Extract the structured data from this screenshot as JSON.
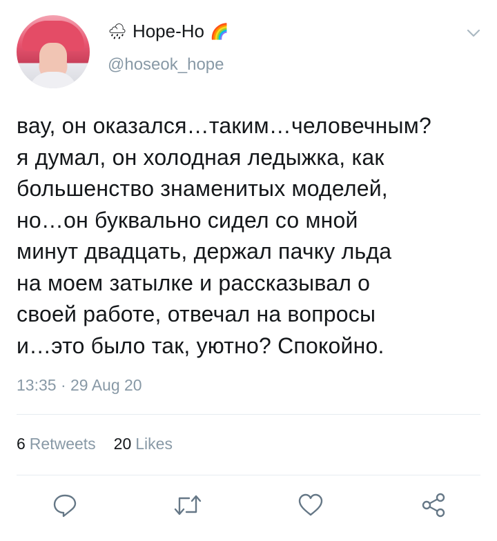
{
  "author": {
    "name": "Hope-Ho",
    "handle": "@hoseok_hope",
    "name_prefix_emoji": "🌧",
    "name_suffix_emoji": "🌈"
  },
  "tweet": {
    "text": "вау, он оказался…таким…человечным?\nя думал, он холодная ледыжка, как\nбольшенство знаменитых моделей,\nно…он буквально сидел со мной\nминут двадцать, держал пачку льда\nна моем затылке и рассказывал о\nсвоей работе, отвечал на вопросы\nи…это было так, уютно? Спокойно.",
    "timestamp": "13:35 · 29 Aug 20"
  },
  "stats": {
    "retweets_count": "6",
    "retweets_label": "Retweets",
    "likes_count": "20",
    "likes_label": "Likes"
  },
  "icons": {
    "menu": "chevron-down-icon",
    "reply": "reply-icon",
    "retweet": "retweet-icon",
    "like": "heart-icon",
    "share": "share-icon"
  },
  "colors": {
    "text": "#14171a",
    "secondary": "#8899a6",
    "divider": "#e6ecf0",
    "icon": "#657786"
  }
}
